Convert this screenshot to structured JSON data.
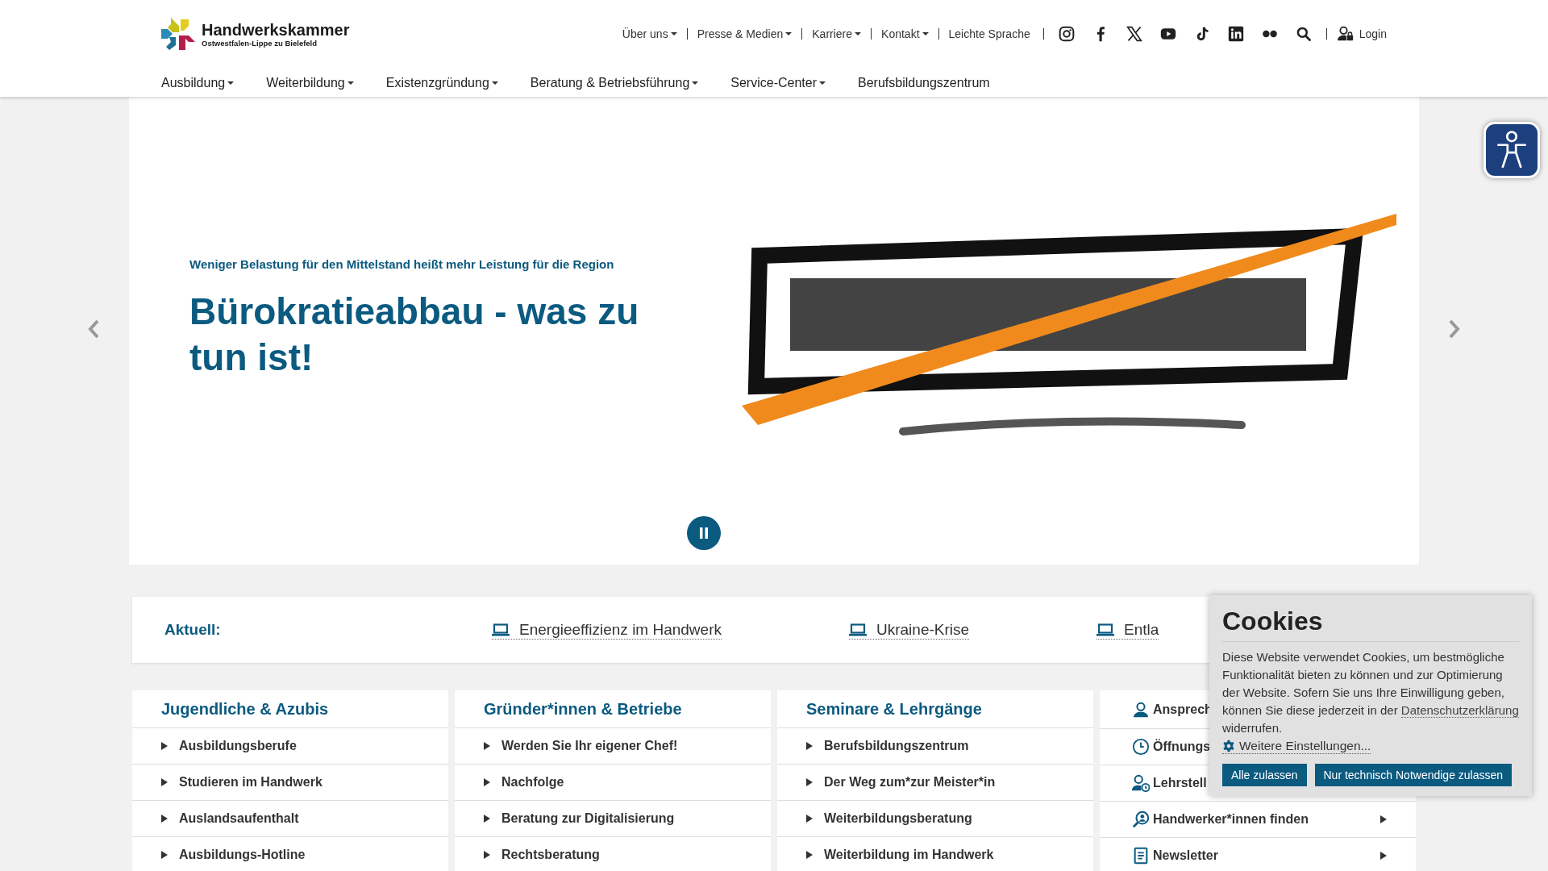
{
  "logo": {
    "name": "Handwerkskammer",
    "subtitle": "Ostwestfalen-Lippe zu Bielefeld"
  },
  "top_links": [
    {
      "label": "Über uns",
      "dropdown": true
    },
    {
      "label": "Presse & Medien",
      "dropdown": true
    },
    {
      "label": "Karriere",
      "dropdown": true
    },
    {
      "label": "Kontakt",
      "dropdown": true
    },
    {
      "label": "Leichte Sprache",
      "dropdown": false
    }
  ],
  "login": "Login",
  "main_nav": [
    {
      "label": "Ausbildung",
      "dropdown": true
    },
    {
      "label": "Weiterbildung",
      "dropdown": true
    },
    {
      "label": "Existenzgründung",
      "dropdown": true
    },
    {
      "label": "Beratung & Betriebsführung",
      "dropdown": true
    },
    {
      "label": "Service-Center",
      "dropdown": true
    },
    {
      "label": "Berufsbildungszentrum",
      "dropdown": false
    }
  ],
  "slider": {
    "playing": true,
    "kicker": "Weniger Belastung für den Mittelstand heißt mehr Leistung für die Region",
    "title": "Bürokratieabbau - was zu tun ist!"
  },
  "news_bar": {
    "label": "Aktuell:",
    "links": [
      "Energieeffizienz im Handwerk",
      "Ukraine-Krise",
      "Entla"
    ]
  },
  "columns": [
    {
      "title": "Jugendliche & Azubis",
      "items": [
        "Ausbildungsberufe",
        "Studieren im Handwerk",
        "Auslandsaufenthalt",
        "Ausbildungs-Hotline"
      ]
    },
    {
      "title": "Gründer*innen & Betriebe",
      "items": [
        "Werden Sie Ihr eigener Chef!",
        "Nachfolge",
        "Beratung zur Digitalisierung",
        "Rechtsberatung"
      ]
    },
    {
      "title": "Seminare & Lehrgänge",
      "items": [
        "Berufsbildungszentrum",
        "Der Weg zum*zur Meister*in",
        "Weiterbildungsberatung",
        "Weiterbildung im Handwerk"
      ]
    }
  ],
  "service_links": [
    {
      "label": "Ansprech",
      "kind": "person"
    },
    {
      "label": "Öffnungs",
      "kind": "clock"
    },
    {
      "label": "Lehrstell",
      "kind": "appointment"
    },
    {
      "label": "Handwerker*innen finden",
      "kind": "finder"
    },
    {
      "label": "Newsletter",
      "kind": "newsletter"
    }
  ],
  "cookie_banner": {
    "title": "Cookies",
    "text_before": "Diese Website verwendet Cookies, um bestmögliche Funktionalität bieten zu können und zur Optimierung der Website. Sofern Sie uns Ihre Einwilligung geben, können Sie diese jederzeit in der",
    "link": "Datenschutzerklärung",
    "text_after": "widerrufen.",
    "settings": "Weitere Einstellungen...",
    "buttons": [
      "Alle zulassen",
      "Nur technisch Notwendige zulassen"
    ]
  }
}
